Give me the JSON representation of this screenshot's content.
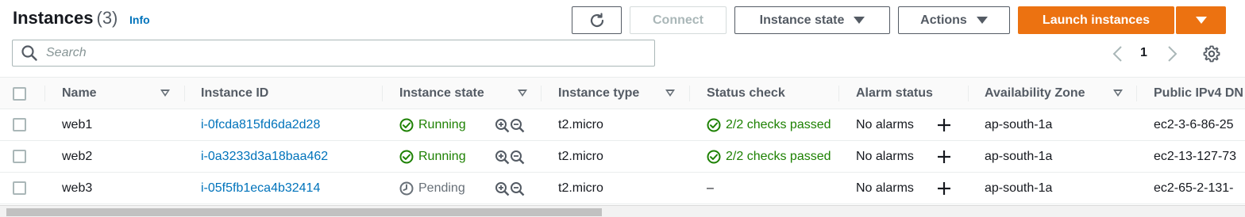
{
  "header": {
    "title": "Instances",
    "count": "(3)",
    "info_label": "Info"
  },
  "toolbar": {
    "refresh_icon": "refresh-icon",
    "connect_label": "Connect",
    "instance_state_label": "Instance state",
    "actions_label": "Actions",
    "launch_label": "Launch instances"
  },
  "search": {
    "placeholder": "Search",
    "value": ""
  },
  "pagination": {
    "current_page": "1"
  },
  "table": {
    "columns": [
      "Name",
      "Instance ID",
      "Instance state",
      "Instance type",
      "Status check",
      "Alarm status",
      "Availability Zone",
      "Public IPv4 DN"
    ],
    "rows": [
      {
        "name": "web1",
        "instance_id": "i-0fcda815fd6da2d28",
        "state": "Running",
        "state_kind": "running",
        "type": "t2.micro",
        "status_check": "2/2 checks passed",
        "alarm_status": "No alarms",
        "zone": "ap-south-1a",
        "public_dns": "ec2-3-6-86-25"
      },
      {
        "name": "web2",
        "instance_id": "i-0a3233d3a18baa462",
        "state": "Running",
        "state_kind": "running",
        "type": "t2.micro",
        "status_check": "2/2 checks passed",
        "alarm_status": "No alarms",
        "zone": "ap-south-1a",
        "public_dns": "ec2-13-127-73"
      },
      {
        "name": "web3",
        "instance_id": "i-05f5fb1eca4b32414",
        "state": "Pending",
        "state_kind": "pending",
        "type": "t2.micro",
        "status_check": "–",
        "alarm_status": "No alarms",
        "zone": "ap-south-1a",
        "public_dns": "ec2-65-2-131-"
      }
    ]
  },
  "colors": {
    "primary": "#ec7211",
    "link": "#0073bb",
    "success": "#1d8102",
    "muted": "#687078"
  }
}
